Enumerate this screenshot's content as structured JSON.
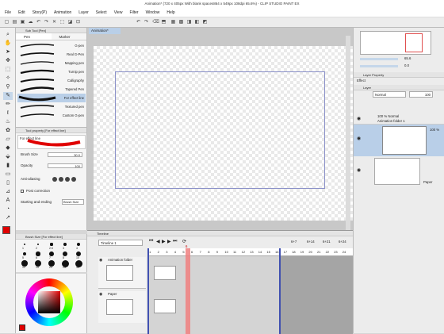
{
  "window": {
    "title": "Animation* (720 x 405px With blank spaces864 x 549px 108dpi 65.6%) - CLIP STUDIO PAINT EX"
  },
  "menu": [
    "File",
    "Edit",
    "Story(P)",
    "Animation",
    "Layer",
    "Select",
    "View",
    "Filter",
    "Window",
    "Help"
  ],
  "subtool": {
    "panel_title": "Sub Tool [Pen]",
    "tabs": [
      "Pen",
      "Marker"
    ],
    "brushes": [
      "G-pen",
      "Real G-Pen",
      "Mapping pen",
      "Turnip pen",
      "Calligraphy",
      "Tapered Pen",
      "For effect line",
      "Textured pen",
      "Custom G-pen"
    ],
    "selected_index": 6
  },
  "toolprop": {
    "panel_title": "Tool property [For effect line]",
    "brush_name": "For effect line",
    "brush_size_label": "Brush Size",
    "brush_size_value": "30.0",
    "opacity_label": "Opacity",
    "opacity_value": "100",
    "antialias_label": "Anti-aliasing",
    "post_correction_label": "Post correction",
    "starting_ending_label": "Starting and ending",
    "starting_ending_value": "Brush Size"
  },
  "brushsize": {
    "panel_title": "Brush Size [For effect line]",
    "sizes": [
      "1",
      "2",
      "2.5",
      "3",
      "4",
      "5",
      "6",
      "7",
      "8",
      "10",
      "12",
      "15",
      "20",
      "25",
      "30"
    ]
  },
  "canvas": {
    "tab_label": "Animation*"
  },
  "navigator": {
    "zoom": "65.6",
    "angle": "0.0"
  },
  "layerprop": {
    "panel_title": "Layer Property",
    "effect_label": "Effect"
  },
  "layer": {
    "tab_label": "Layer",
    "blend_mode": "Normal",
    "opacity": "100",
    "items": [
      {
        "title": "100 % Normal",
        "name": "Animation folder 1"
      },
      {
        "title": "100 %",
        "name": ""
      },
      {
        "title": "",
        "name": "Paper"
      }
    ]
  },
  "timeline": {
    "panel_title": "Timeline",
    "name": "Timeline 1",
    "frame_numbers": [
      "1",
      "2",
      "3",
      "4",
      "5",
      "6",
      "7",
      "8",
      "9",
      "10",
      "11",
      "12",
      "13",
      "14",
      "15",
      "16",
      "17",
      "18",
      "19",
      "20",
      "21",
      "22",
      "23",
      "24"
    ],
    "current_frame": "6",
    "markers": [
      "6+7",
      "6+14",
      "6+21",
      "6+24"
    ],
    "tracks": [
      {
        "name": "Animation folder"
      },
      {
        "name": "Paper"
      }
    ]
  },
  "colors": {
    "accent": "#b9cfe8",
    "playhead": "#f08080",
    "main_color": "#e00000",
    "frame_border": "#8a90c8"
  }
}
